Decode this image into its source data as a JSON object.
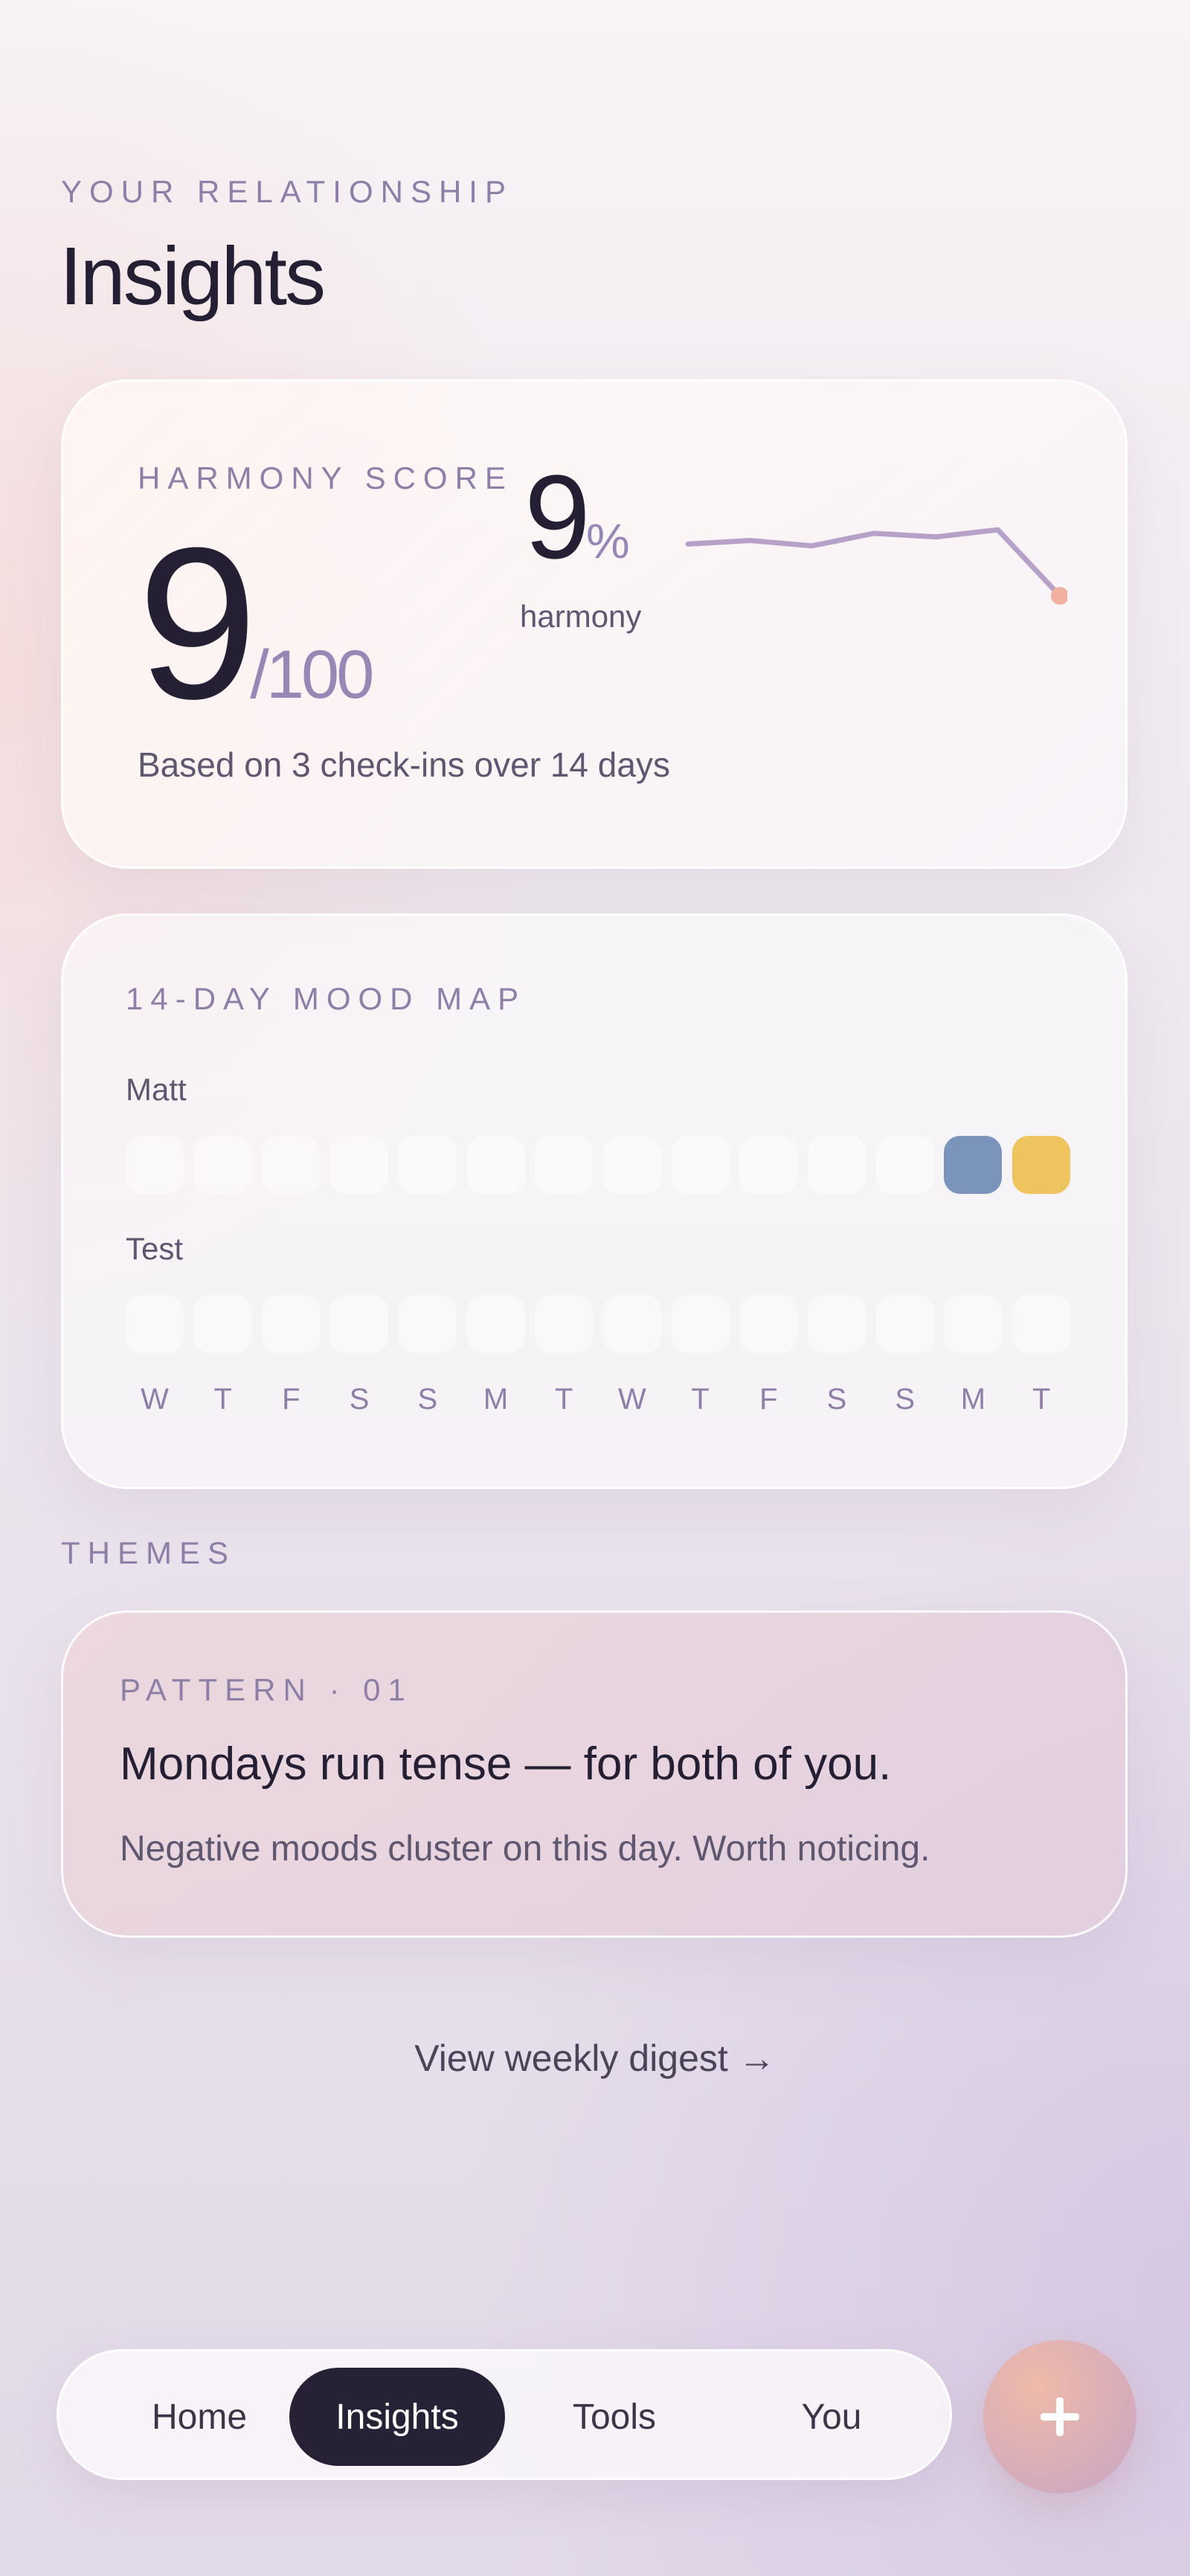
{
  "header": {
    "eyebrow": "YOUR RELATIONSHIP",
    "title": "Insights"
  },
  "harmony": {
    "label": "HARMONY SCORE",
    "score": "9",
    "max": "/100",
    "percent_value": "9",
    "percent_sign": "%",
    "percent_caption": "harmony",
    "basis": "Based on 3 check-ins over 14 days",
    "sparkline_values": [
      0.18,
      0.22,
      0.16,
      0.3,
      0.26,
      0.34,
      -0.4
    ],
    "line_color": "#b6a2c8",
    "endpoint_color": "#f2b0a0"
  },
  "mood_map": {
    "label": "14-DAY MOOD MAP",
    "rows": [
      {
        "name": "Matt",
        "cells": [
          null,
          null,
          null,
          null,
          null,
          null,
          null,
          null,
          null,
          null,
          null,
          null,
          "#7b94bb",
          "#eec45e"
        ]
      },
      {
        "name": "Test",
        "cells": [
          null,
          null,
          null,
          null,
          null,
          null,
          null,
          null,
          null,
          null,
          null,
          null,
          null,
          null
        ]
      }
    ],
    "days": [
      "W",
      "T",
      "F",
      "S",
      "S",
      "M",
      "T",
      "W",
      "T",
      "F",
      "S",
      "S",
      "M",
      "T"
    ]
  },
  "themes": {
    "label": "THEMES",
    "pattern": {
      "eyebrow": "PATTERN · 01",
      "title": "Mondays run tense — for both of you.",
      "description": "Negative moods cluster on this day. Worth noticing."
    }
  },
  "digest_link": "View weekly digest →",
  "nav": {
    "items": [
      "Home",
      "Insights",
      "Tools",
      "You"
    ],
    "active_index": 1,
    "fab_icon": "plus-icon"
  }
}
